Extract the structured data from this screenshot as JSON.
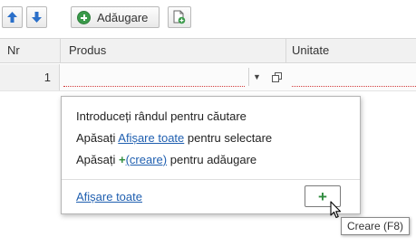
{
  "toolbar": {
    "up_icon": "arrow-up-icon",
    "down_icon": "arrow-down-icon",
    "add_label": "Adăugare",
    "add_icon": "plus-circle-icon",
    "new_doc_icon": "new-document-icon"
  },
  "grid": {
    "columns": [
      "Nr",
      "Produs",
      "Unitate"
    ],
    "rows": [
      {
        "nr": "1",
        "produs": "",
        "unitate": ""
      }
    ]
  },
  "popup": {
    "line1": "Introduceți rândul pentru căutare",
    "line2_prefix": "Apăsați",
    "line2_link": "Afișare toate",
    "line2_suffix": "pentru selectare",
    "line3_prefix": "Apăsați",
    "line3_plus": "+",
    "line3_link": "(creare)",
    "line3_suffix": "pentru adăugare",
    "bottom_link": "Afișare toate",
    "create_button_symbol": "+"
  },
  "tooltip": {
    "text": "Creare (F8)"
  },
  "colors": {
    "accent_blue": "#2a6fc9",
    "green": "#2e8b3d",
    "link": "#1f5fb0",
    "required_underline": "#d23a3a"
  }
}
